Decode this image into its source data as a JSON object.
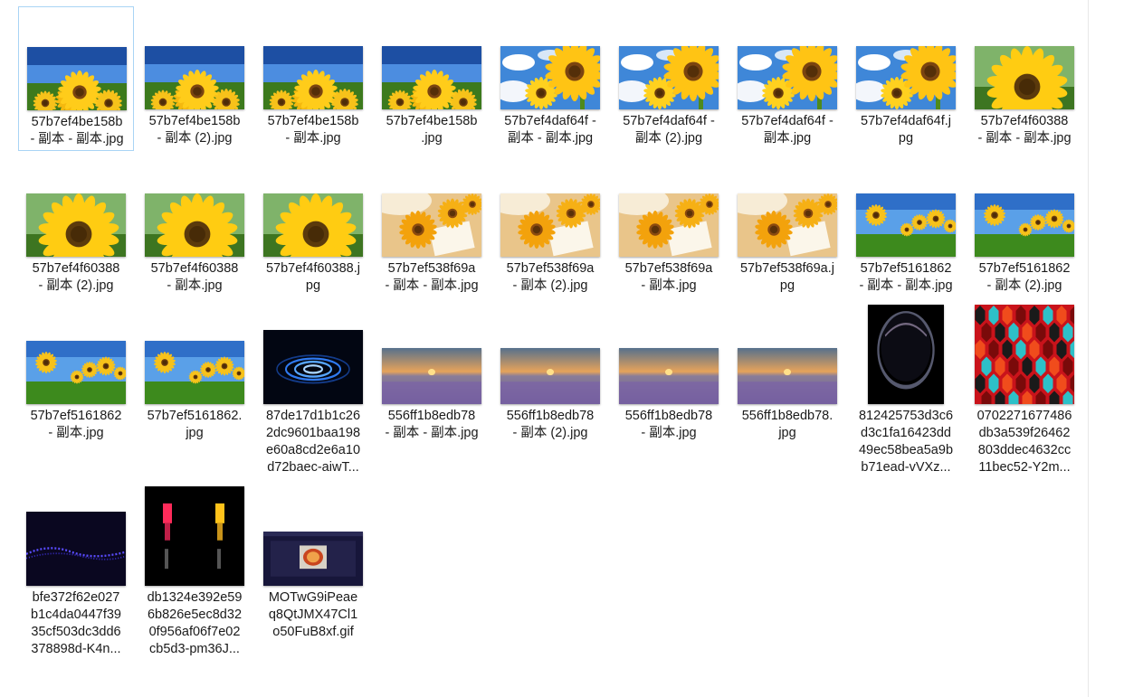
{
  "window": {
    "scroll": "vertical"
  },
  "files": [
    {
      "name": "57b7ef4be158b\n- 副本 - 副本.jpg",
      "kind": "sunflower-sky",
      "selected": true
    },
    {
      "name": "57b7ef4be158b\n- 副本 (2).jpg",
      "kind": "sunflower-sky"
    },
    {
      "name": "57b7ef4be158b\n- 副本.jpg",
      "kind": "sunflower-sky"
    },
    {
      "name": "57b7ef4be158b\n.jpg",
      "kind": "sunflower-sky"
    },
    {
      "name": "57b7ef4daf64f -\n副本 - 副本.jpg",
      "kind": "sunflower-clouds"
    },
    {
      "name": "57b7ef4daf64f -\n副本 (2).jpg",
      "kind": "sunflower-clouds"
    },
    {
      "name": "57b7ef4daf64f -\n副本.jpg",
      "kind": "sunflower-clouds"
    },
    {
      "name": "57b7ef4daf64f.j\npg",
      "kind": "sunflower-clouds"
    },
    {
      "name": "57b7ef4f60388\n- 副本 - 副本.jpg",
      "kind": "sunflower-closeup"
    },
    {
      "name": "57b7ef4f60388\n- 副本 (2).jpg",
      "kind": "sunflower-closeup"
    },
    {
      "name": "57b7ef4f60388\n- 副本.jpg",
      "kind": "sunflower-closeup"
    },
    {
      "name": "57b7ef4f60388.j\npg",
      "kind": "sunflower-closeup"
    },
    {
      "name": "57b7ef538f69a\n- 副本 - 副本.jpg",
      "kind": "sunflower-card"
    },
    {
      "name": "57b7ef538f69a\n- 副本 (2).jpg",
      "kind": "sunflower-card"
    },
    {
      "name": "57b7ef538f69a\n- 副本.jpg",
      "kind": "sunflower-card"
    },
    {
      "name": "57b7ef538f69a.j\npg",
      "kind": "sunflower-card"
    },
    {
      "name": "57b7ef5161862\n- 副本 - 副本.jpg",
      "kind": "sunflower-field"
    },
    {
      "name": "57b7ef5161862\n- 副本 (2).jpg",
      "kind": "sunflower-field"
    },
    {
      "name": "57b7ef5161862\n- 副本.jpg",
      "kind": "sunflower-field"
    },
    {
      "name": "57b7ef5161862.\njpg",
      "kind": "sunflower-field"
    },
    {
      "name": "87de17d1b1c26\n2dc9601baa198\ne60a8cd2e6a10\nd72baec-aiwT...",
      "kind": "blue-rings"
    },
    {
      "name": "556ff1b8edb78\n- 副本 - 副本.jpg",
      "kind": "lavender-sunset"
    },
    {
      "name": "556ff1b8edb78\n- 副本 (2).jpg",
      "kind": "lavender-sunset"
    },
    {
      "name": "556ff1b8edb78\n- 副本.jpg",
      "kind": "lavender-sunset"
    },
    {
      "name": "556ff1b8edb78.\njpg",
      "kind": "lavender-sunset"
    },
    {
      "name": "812425753d3c6\nd3c1fa16423dd\n49ec58bea5a9b\nb71ead-vVXz...",
      "kind": "dark-bubble"
    },
    {
      "name": "0702271677486\ndb3a539f26462\n803ddec4632cc\n11bec52-Y2m...",
      "kind": "hexagons"
    },
    {
      "name": "bfe372f62e027\nb1c4da0447f39\n35cf503dc3dd6\n378898d-K4n...",
      "kind": "purple-wave"
    },
    {
      "name": "db1324e392e59\n6b826e5ec8d32\n0f956af06f7e02\ncb5d3-pm36J...",
      "kind": "figures"
    },
    {
      "name": "MOTwG9iPeae\nq8QtJMX47Cl1\no50FuB8xf.gif",
      "kind": "webpage"
    }
  ]
}
